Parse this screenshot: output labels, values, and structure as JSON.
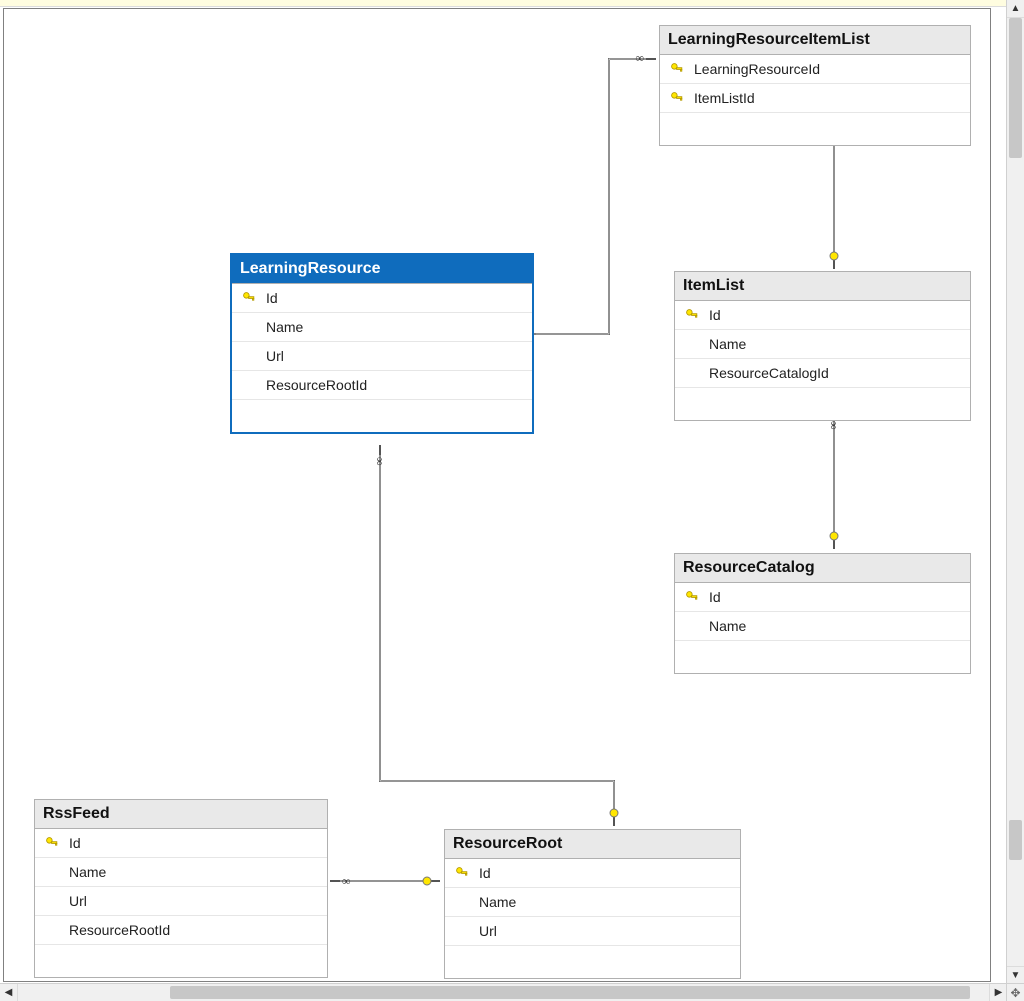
{
  "tables": {
    "learningResourceItemList": {
      "title": "LearningResourceItemList",
      "columns": [
        {
          "name": "LearningResourceId",
          "key": true
        },
        {
          "name": "ItemListId",
          "key": true
        }
      ]
    },
    "learningResource": {
      "title": "LearningResource",
      "selected": true,
      "columns": [
        {
          "name": "Id",
          "key": true
        },
        {
          "name": "Name",
          "key": false
        },
        {
          "name": "Url",
          "key": false
        },
        {
          "name": "ResourceRootId",
          "key": false
        }
      ]
    },
    "itemList": {
      "title": "ItemList",
      "columns": [
        {
          "name": "Id",
          "key": true
        },
        {
          "name": "Name",
          "key": false
        },
        {
          "name": "ResourceCatalogId",
          "key": false
        }
      ]
    },
    "resourceCatalog": {
      "title": "ResourceCatalog",
      "columns": [
        {
          "name": "Id",
          "key": true
        },
        {
          "name": "Name",
          "key": false
        }
      ]
    },
    "rssFeed": {
      "title": "RssFeed",
      "columns": [
        {
          "name": "Id",
          "key": true
        },
        {
          "name": "Name",
          "key": false
        },
        {
          "name": "Url",
          "key": false
        },
        {
          "name": "ResourceRootId",
          "key": false
        }
      ]
    },
    "resourceRoot": {
      "title": "ResourceRoot",
      "columns": [
        {
          "name": "Id",
          "key": true
        },
        {
          "name": "Name",
          "key": false
        },
        {
          "name": "Url",
          "key": false
        }
      ]
    }
  },
  "relationships": [
    {
      "from": "LearningResourceItemList.LearningResourceId",
      "to": "LearningResource.Id"
    },
    {
      "from": "LearningResourceItemList.ItemListId",
      "to": "ItemList.Id"
    },
    {
      "from": "ItemList.ResourceCatalogId",
      "to": "ResourceCatalog.Id"
    },
    {
      "from": "LearningResource.ResourceRootId",
      "to": "ResourceRoot.Id"
    },
    {
      "from": "RssFeed.ResourceRootId",
      "to": "ResourceRoot.Id"
    }
  ]
}
